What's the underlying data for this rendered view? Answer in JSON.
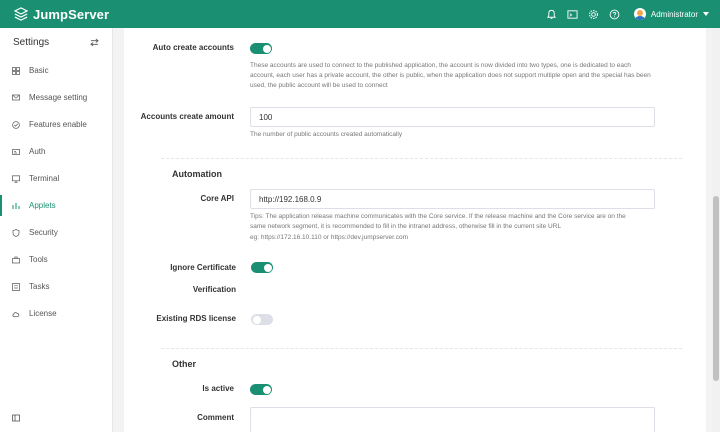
{
  "app": {
    "name": "JumpServer"
  },
  "header": {
    "user_name": "Administrator"
  },
  "sidebar": {
    "title": "Settings",
    "items": [
      {
        "label": "Basic"
      },
      {
        "label": "Message setting"
      },
      {
        "label": "Features enable"
      },
      {
        "label": "Auth"
      },
      {
        "label": "Terminal"
      },
      {
        "label": "Applets"
      },
      {
        "label": "Security"
      },
      {
        "label": "Tools"
      },
      {
        "label": "Tasks"
      },
      {
        "label": "License"
      }
    ],
    "active_item": "Applets"
  },
  "form": {
    "auto_create": {
      "label": "Auto create accounts",
      "enabled": true,
      "help": "These accounts are used to connect to the published application, the account is now divided into two types, one is dedicated to each account, each user has a private account, the other is public, when the application does not support multiple open and the special has been used, the public account will be used to connect"
    },
    "accounts_amount": {
      "label": "Accounts create amount",
      "value": "100",
      "help": "The number of public accounts created automatically"
    },
    "automation": {
      "title": "Automation",
      "core_api": {
        "label": "Core API",
        "value": "http://192.168.0.9",
        "help_line1": "Tips: The application release machine communicates with the Core service. If the release machine and the Core service are on the",
        "help_line2": "same network segment, it is recommended to fill in the intranet address, otherwise fill in the current site URL",
        "help_line3": "eg: https://172.16.10.110 or https://dev.jumpserver.com"
      },
      "ignore_cert": {
        "label_line1": "Ignore Certificate",
        "label_line2": "Verification",
        "enabled": true
      },
      "rds_license": {
        "label": "Existing RDS license",
        "enabled": false
      }
    },
    "other": {
      "title": "Other",
      "is_active": {
        "label": "Is active",
        "enabled": true
      },
      "comment": {
        "label": "Comment",
        "value": ""
      }
    }
  },
  "colors": {
    "brand": "#1a8f72",
    "switch_off": "#dcdfe6"
  }
}
